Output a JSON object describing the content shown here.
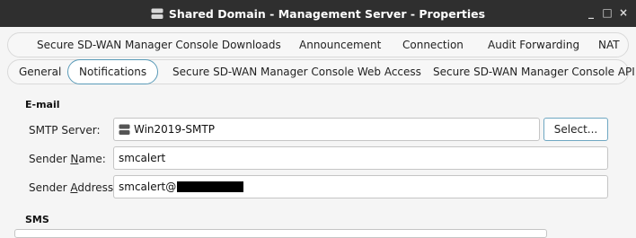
{
  "window": {
    "title": "Shared Domain - Management Server - Properties",
    "minimize_glyph": "_",
    "maximize_glyph": "□",
    "close_glyph": "×"
  },
  "tabs_row1": [
    {
      "label": "Secure SD-WAN Manager Console Downloads"
    },
    {
      "label": "Announcement"
    },
    {
      "label": "Connection"
    },
    {
      "label": "Audit Forwarding"
    },
    {
      "label": "NAT"
    }
  ],
  "tabs_row2": [
    {
      "label": "General"
    },
    {
      "label": "Notifications",
      "active": true
    },
    {
      "label": "Secure SD-WAN Manager Console Web Access"
    },
    {
      "label": "Secure SD-WAN Manager Console API"
    }
  ],
  "email": {
    "section_title": "E-mail",
    "smtp_server": {
      "label": "SMTP Server:",
      "value": "Win2019-SMTP",
      "icon": "server-icon"
    },
    "select_button": "Select...",
    "sender_name": {
      "label_before": "Sender ",
      "label_mnemonic": "N",
      "label_after": "ame:",
      "value": "smcalert"
    },
    "sender_address": {
      "label_before": "Sender ",
      "label_mnemonic": "A",
      "label_after": "ddress:",
      "value": "smcalert@"
    }
  },
  "sms": {
    "section_title": "SMS"
  },
  "colors": {
    "titlebar": "#2f2f2f",
    "active_tab_border": "#5a9bb8",
    "select_border": "#6fa7c2",
    "background": "#f5f5f5"
  }
}
